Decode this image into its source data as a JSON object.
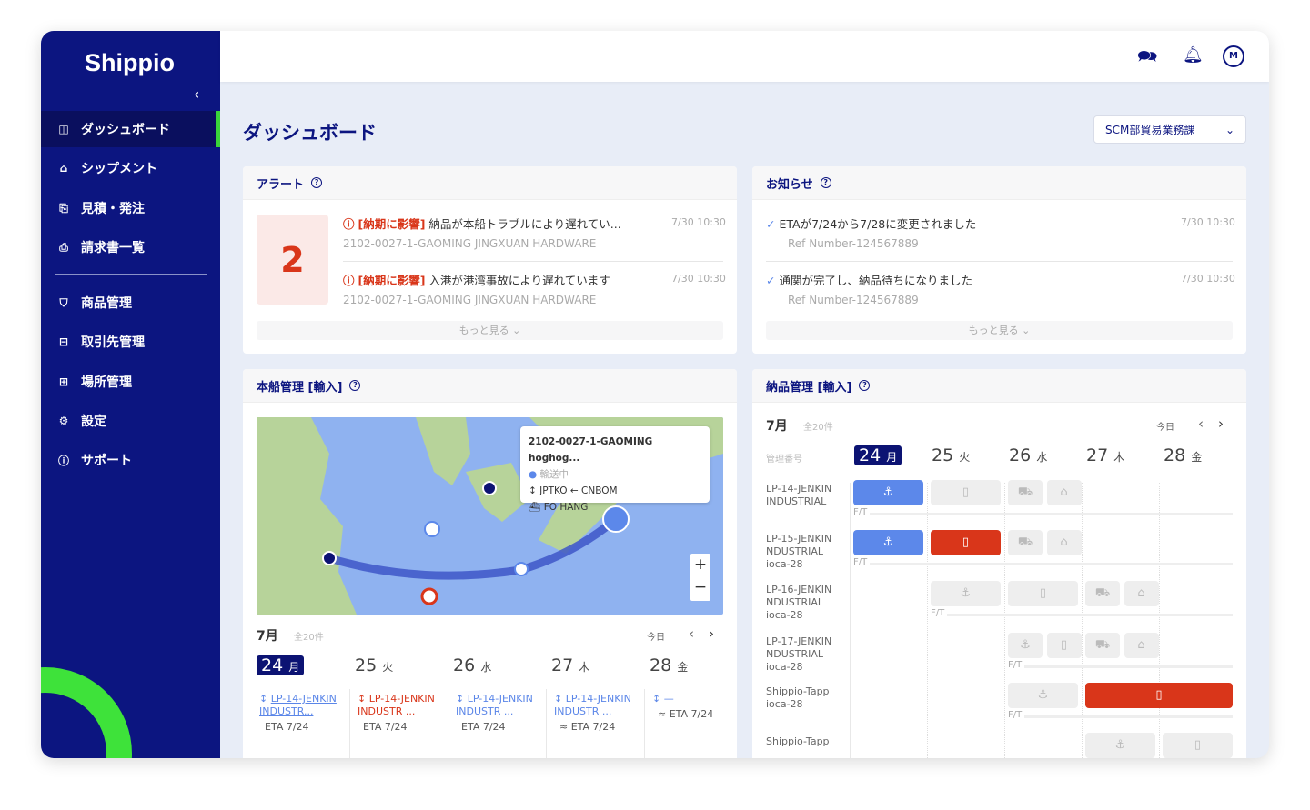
{
  "app": {
    "logo": "Shippio"
  },
  "colors": {
    "sidebar": "#0c1580",
    "accent_green": "#3ee23a",
    "alert_red": "#d9361a",
    "status_blue": "#5c88ea"
  },
  "sidebar": {
    "items": [
      {
        "label": "ダッシュボード",
        "icon": "dashboard-icon",
        "active": true
      },
      {
        "label": "シップメント",
        "icon": "ship-icon"
      },
      {
        "label": "見積・発注",
        "icon": "quote-icon"
      },
      {
        "label": "請求書一覧",
        "icon": "invoice-icon"
      },
      {
        "label": "商品管理",
        "icon": "product-icon"
      },
      {
        "label": "取引先管理",
        "icon": "partner-icon"
      },
      {
        "label": "場所管理",
        "icon": "place-icon"
      },
      {
        "label": "設定",
        "icon": "gear-icon"
      },
      {
        "label": "サポート",
        "icon": "info-icon"
      }
    ]
  },
  "header": {
    "avatar": "M"
  },
  "page": {
    "title": "ダッシュボード",
    "department": "SCM部貿易業務課"
  },
  "alerts": {
    "title": "アラート",
    "count": "2",
    "more": "もっと見る",
    "items": [
      {
        "tag": "[納期に影響]",
        "text": "納品が本船トラブルにより遅れてい...",
        "sub": "2102-0027-1-GAOMING JINGXUAN HARDWARE",
        "time": "7/30 10:30"
      },
      {
        "tag": "[納期に影響]",
        "text": "入港が港湾事故により遅れています",
        "sub": "2102-0027-1-GAOMING JINGXUAN HARDWARE",
        "time": "7/30 10:30"
      }
    ]
  },
  "notices": {
    "title": "お知らせ",
    "more": "もっと見る",
    "items": [
      {
        "text": "ETAが7/24から7/28に変更されました",
        "sub": "Ref Number-124567889",
        "time": "7/30 10:30"
      },
      {
        "text": "通関が完了し、納品待ちになりました",
        "sub": "Ref Number-124567889",
        "time": "7/30 10:30"
      }
    ]
  },
  "vessel": {
    "title": "本船管理 [輸入]",
    "tooltip": {
      "title": "2102-0027-1-GAOMING hoghog...",
      "status": "輸送中",
      "route": "JPTKO ← CNBOM",
      "vessel": "FO HANG"
    },
    "month": "7月",
    "count": "全20件",
    "today": "今日",
    "days": [
      {
        "d": "24",
        "w": "月"
      },
      {
        "d": "25",
        "w": "火"
      },
      {
        "d": "26",
        "w": "水"
      },
      {
        "d": "27",
        "w": "木"
      },
      {
        "d": "28",
        "w": "金"
      }
    ],
    "shipments": [
      {
        "name": "LP-14-JENKIN INDUSTR...",
        "eta": "ETA 7/24",
        "color": "blue"
      },
      {
        "name": "LP-14-JENKIN INDUSTR ...",
        "eta": "ETA 7/24",
        "color": "red"
      },
      {
        "name": "LP-14-JENKIN INDUSTR ...",
        "eta": "ETA 7/24",
        "color": "blue"
      },
      {
        "name": "LP-14-JENKIN INDUSTR ...",
        "eta": "≈ ETA 7/24",
        "color": "blue"
      },
      {
        "name": "—",
        "eta": "≈ ETA 7/24",
        "color": "blue"
      }
    ]
  },
  "delivery": {
    "title": "納品管理 [輸入]",
    "month": "7月",
    "count": "全20件",
    "today": "今日",
    "col_header": "管理番号",
    "ft": "F/T",
    "days": [
      {
        "d": "24",
        "w": "月"
      },
      {
        "d": "25",
        "w": "火"
      },
      {
        "d": "26",
        "w": "水"
      },
      {
        "d": "27",
        "w": "木"
      },
      {
        "d": "28",
        "w": "金"
      }
    ],
    "rows": [
      "LP-14-JENKIN INDUSTRIAL",
      "LP-15-JENKIN NDUSTRIAL ioca-28",
      "LP-16-JENKIN NDUSTRIAL ioca-28",
      "LP-17-JENKIN NDUSTRIAL ioca-28",
      "Shippio-Tapp ioca-28",
      "Shippio-Tapp"
    ]
  }
}
